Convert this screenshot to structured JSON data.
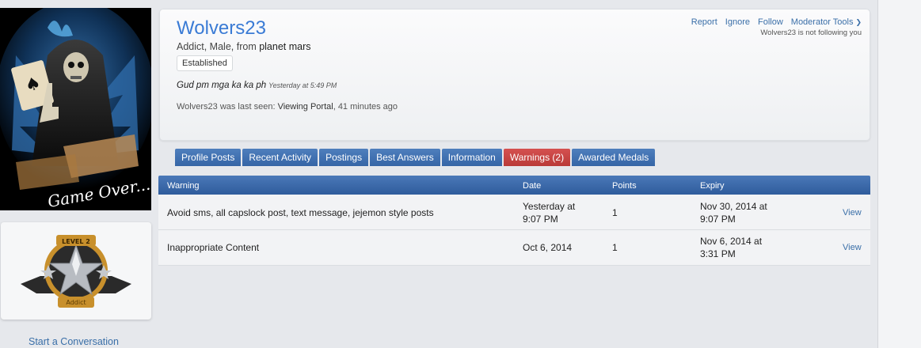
{
  "profile": {
    "username": "Wolvers23",
    "title_prefix": "Addict, Male, from ",
    "location": "planet mars",
    "badge": "Established",
    "status_message": "Gud pm mga ka ka ph",
    "status_time": "Yesterday at 5:49 PM",
    "last_seen_prefix": "Wolvers23 was last seen: ",
    "last_seen_location": "Viewing Portal",
    "last_seen_time": ", 41 minutes ago",
    "follow_note": "Wolvers23 is not following you"
  },
  "actions": {
    "report": "Report",
    "ignore": "Ignore",
    "follow": "Follow",
    "moderator_tools": "Moderator Tools"
  },
  "tabs": [
    {
      "label": "Profile Posts",
      "active": false
    },
    {
      "label": "Recent Activity",
      "active": false
    },
    {
      "label": "Postings",
      "active": false
    },
    {
      "label": "Best Answers",
      "active": false
    },
    {
      "label": "Information",
      "active": false
    },
    {
      "label": "Warnings (2)",
      "active": true
    },
    {
      "label": "Awarded Medals",
      "active": false
    }
  ],
  "warnings_table": {
    "headers": {
      "warning": "Warning",
      "date": "Date",
      "points": "Points",
      "expiry": "Expiry"
    },
    "rows": [
      {
        "warning": "Avoid sms, all capslock post, text message, jejemon style posts",
        "date_line1": "Yesterday at",
        "date_line2": "9:07 PM",
        "points": "1",
        "expiry_line1": "Nov 30, 2014 at",
        "expiry_line2": "9:07 PM",
        "view": "View"
      },
      {
        "warning": "Inappropriate Content",
        "date_line1": "Oct 6, 2014",
        "date_line2": "",
        "points": "1",
        "expiry_line1": "Nov 6, 2014 at",
        "expiry_line2": "3:31 PM",
        "view": "View"
      }
    ]
  },
  "sidebar": {
    "avatar_caption": "Game Over...",
    "rank_top": "LEVEL 2",
    "rank_bottom": "Addict",
    "start_conversation": "Start a Conversation"
  },
  "colors": {
    "accent": "#3a7bd5",
    "tab_blue": "#3565a6",
    "tab_active": "#b93a38",
    "link": "#3a6fa8"
  },
  "icons": {
    "moderator_tools": "chevron-down-icon"
  }
}
